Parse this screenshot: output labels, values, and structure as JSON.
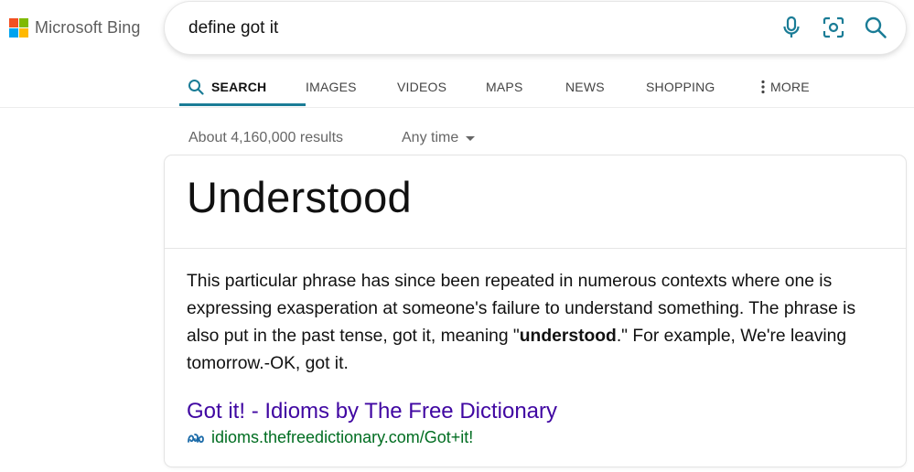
{
  "brand": {
    "name": "Microsoft Bing",
    "colors": [
      "#f25022",
      "#7fba00",
      "#00a4ef",
      "#ffb900"
    ]
  },
  "search": {
    "query": "define got it",
    "icons": [
      "microphone-icon",
      "visual-search-icon",
      "search-icon"
    ],
    "accent": "#1a7c96"
  },
  "nav": {
    "tabs": [
      {
        "label": "SEARCH",
        "active": true
      },
      {
        "label": "IMAGES"
      },
      {
        "label": "VIDEOS"
      },
      {
        "label": "MAPS"
      },
      {
        "label": "NEWS"
      },
      {
        "label": "SHOPPING"
      },
      {
        "label": "MORE"
      }
    ]
  },
  "results": {
    "count": "About 4,160,000 results",
    "time_filter": "Any time"
  },
  "answer": {
    "headline": "Understood",
    "snippet_before": "This particular phrase has since been repeated in numerous contexts where one is expressing exasperation at someone's failure to understand something. The phrase is also put in the past tense, got it, meaning \"",
    "snippet_bold": "understood",
    "snippet_after": ".\" For example, We're leaving tomorrow.-OK, got it.",
    "source_title": "Got it! - Idioms by The Free Dictionary",
    "source_url": "idioms.thefreedictionary.com/Got+it!",
    "link_color": "#4007a2",
    "url_color": "#006d21"
  }
}
